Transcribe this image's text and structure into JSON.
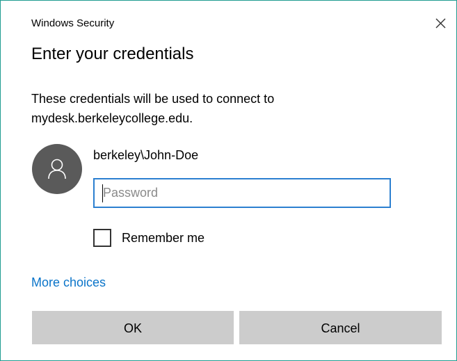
{
  "window": {
    "title": "Windows Security",
    "close_icon": "close-icon",
    "border_color": "#1f9c91"
  },
  "dialog": {
    "heading": "Enter your credentials",
    "description": "These credentials will be used to connect to mydesk.berkeleycollege.edu."
  },
  "account": {
    "avatar_icon": "user-icon",
    "username": "berkeley\\John-Doe"
  },
  "password": {
    "value": "",
    "placeholder": "Password",
    "focus_color": "#2b7fd0"
  },
  "remember": {
    "label": "Remember me",
    "checked": false
  },
  "links": {
    "more_choices": "More choices",
    "link_color": "#0a74c9"
  },
  "buttons": {
    "ok": "OK",
    "cancel": "Cancel",
    "button_color": "#cccccc"
  }
}
